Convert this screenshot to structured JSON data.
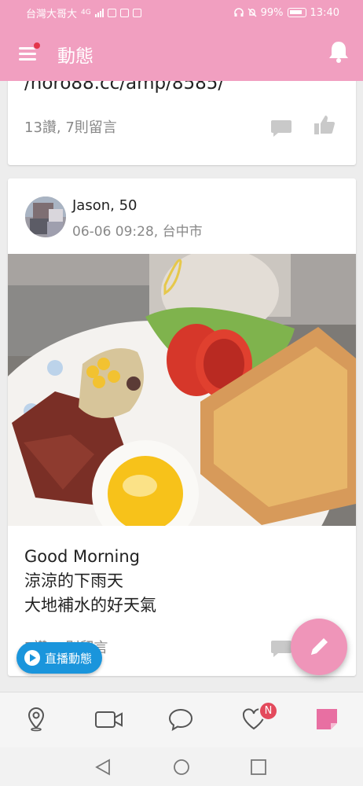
{
  "status_bar": {
    "carrier": "台灣大哥大",
    "net": "4G",
    "battery": "99%",
    "time": "13:40"
  },
  "app_bar": {
    "title": "動態",
    "menu_icon": "hamburger-menu-icon",
    "bell_icon": "bell-icon"
  },
  "posts": [
    {
      "link_text": "/horo88.cc/amp/8585/",
      "stats": "13讚, 7則留言"
    },
    {
      "author": "Jason, 50",
      "meta": "06-06 09:28, 台中市",
      "photo": "breakfast-photo",
      "text": [
        "Good Morning",
        "涼涼的下雨天",
        "大地補水的好天氣"
      ],
      "stats": "7讚, 4則留言"
    }
  ],
  "live_button": {
    "label": "直播動態",
    "icon": "play-circle-icon"
  },
  "fab": {
    "icon": "pencil-icon"
  },
  "tabs": [
    {
      "icon": "location-pin-icon"
    },
    {
      "icon": "video-camera-icon"
    },
    {
      "icon": "chat-bubble-icon"
    },
    {
      "icon": "heart-icon",
      "badge": "N"
    },
    {
      "icon": "note-icon"
    }
  ],
  "colors": {
    "primary": "#f19fc0",
    "accent": "#1a95dc",
    "badge": "#e34a5c"
  }
}
